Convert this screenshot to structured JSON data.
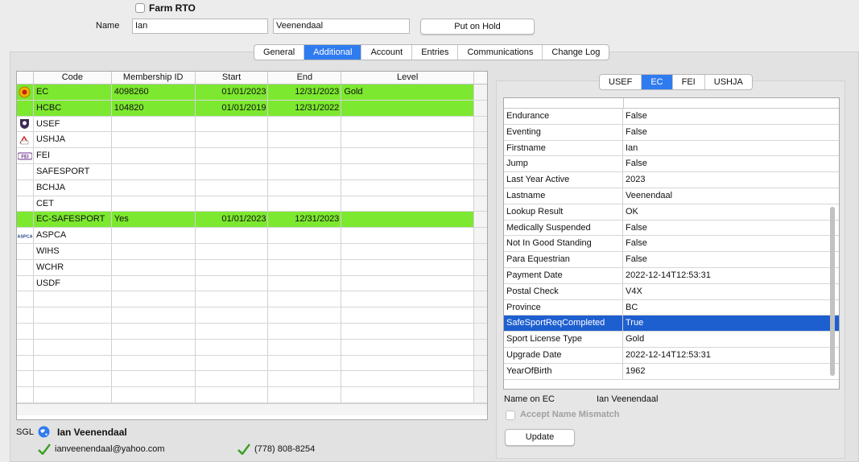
{
  "window": {
    "farm_rto_label": "Farm RTO",
    "name_label": "Name",
    "first_name": "Ian",
    "last_name": "Veenendaal",
    "hold_button": "Put on Hold"
  },
  "tabs": [
    "General",
    "Additional",
    "Account",
    "Entries",
    "Communications",
    "Change Log"
  ],
  "active_tab": "Additional",
  "memberships": {
    "columns": [
      "Code",
      "Membership ID",
      "Start",
      "End",
      "Level"
    ],
    "rows": [
      {
        "icon": "ec-logo-icon",
        "code": "EC",
        "id": "4098260",
        "start": "01/01/2023",
        "end": "12/31/2023",
        "level": "Gold",
        "highlight": true
      },
      {
        "icon": "",
        "code": "HCBC",
        "id": "104820",
        "start": "01/01/2019",
        "end": "12/31/2022",
        "level": "",
        "highlight": true
      },
      {
        "icon": "usef-logo-icon",
        "code": "USEF",
        "id": "",
        "start": "",
        "end": "",
        "level": "",
        "highlight": false
      },
      {
        "icon": "ushja-logo-icon",
        "code": "USHJA",
        "id": "",
        "start": "",
        "end": "",
        "level": "",
        "highlight": false
      },
      {
        "icon": "fei-logo-icon",
        "code": "FEI",
        "id": "",
        "start": "",
        "end": "",
        "level": "",
        "highlight": false
      },
      {
        "icon": "",
        "code": "SAFESPORT",
        "id": "",
        "start": "",
        "end": "",
        "level": "",
        "highlight": false
      },
      {
        "icon": "",
        "code": "BCHJA",
        "id": "",
        "start": "",
        "end": "",
        "level": "",
        "highlight": false
      },
      {
        "icon": "",
        "code": "CET",
        "id": "",
        "start": "",
        "end": "",
        "level": "",
        "highlight": false
      },
      {
        "icon": "",
        "code": "EC-SAFESPORT",
        "id": "Yes",
        "start": "01/01/2023",
        "end": "12/31/2023",
        "level": "",
        "highlight": true
      },
      {
        "icon": "aspca-logo-icon",
        "code": "ASPCA",
        "id": "",
        "start": "",
        "end": "",
        "level": "",
        "highlight": false
      },
      {
        "icon": "",
        "code": "WIHS",
        "id": "",
        "start": "",
        "end": "",
        "level": "",
        "highlight": false
      },
      {
        "icon": "",
        "code": "WCHR",
        "id": "",
        "start": "",
        "end": "",
        "level": "",
        "highlight": false
      },
      {
        "icon": "",
        "code": "USDF",
        "id": "",
        "start": "",
        "end": "",
        "level": "",
        "highlight": false
      }
    ],
    "empty_rows": 7
  },
  "contact": {
    "sgl_label": "SGL",
    "name": "Ian Veenendaal",
    "email": "ianveenendaal@yahoo.com",
    "phone": "(778) 808-8254"
  },
  "org_tabs": [
    "USEF",
    "EC",
    "FEI",
    "USHJA"
  ],
  "active_org_tab": "EC",
  "details": {
    "rows": [
      {
        "key": "Endurance",
        "value": "False"
      },
      {
        "key": "Eventing",
        "value": "False"
      },
      {
        "key": "Firstname",
        "value": "Ian"
      },
      {
        "key": "Jump",
        "value": "False"
      },
      {
        "key": "Last Year Active",
        "value": "2023"
      },
      {
        "key": "Lastname",
        "value": "Veenendaal"
      },
      {
        "key": "Lookup Result",
        "value": "OK"
      },
      {
        "key": "Medically Suspended",
        "value": "False"
      },
      {
        "key": "Not In Good Standing",
        "value": "False"
      },
      {
        "key": "Para Equestrian",
        "value": "False"
      },
      {
        "key": "Payment Date",
        "value": "2022-12-14T12:53:31"
      },
      {
        "key": "Postal Check",
        "value": "V4X"
      },
      {
        "key": "Province",
        "value": "BC"
      },
      {
        "key": "SafeSportReqCompleted",
        "value": "True",
        "selected": true
      },
      {
        "key": "Sport License Type",
        "value": "Gold"
      },
      {
        "key": "Upgrade Date",
        "value": "2022-12-14T12:53:31"
      },
      {
        "key": "YearOfBirth",
        "value": "1962"
      }
    ]
  },
  "name_on_ec_label": "Name on EC",
  "name_on_ec_value": "Ian Veenendaal",
  "accept_mismatch_label": "Accept Name Mismatch",
  "update_button": "Update",
  "colors": {
    "highlight": "#7ce82f",
    "selected": "#1e5fd0",
    "accent": "#2f7bf0",
    "check": "#3aa020"
  }
}
